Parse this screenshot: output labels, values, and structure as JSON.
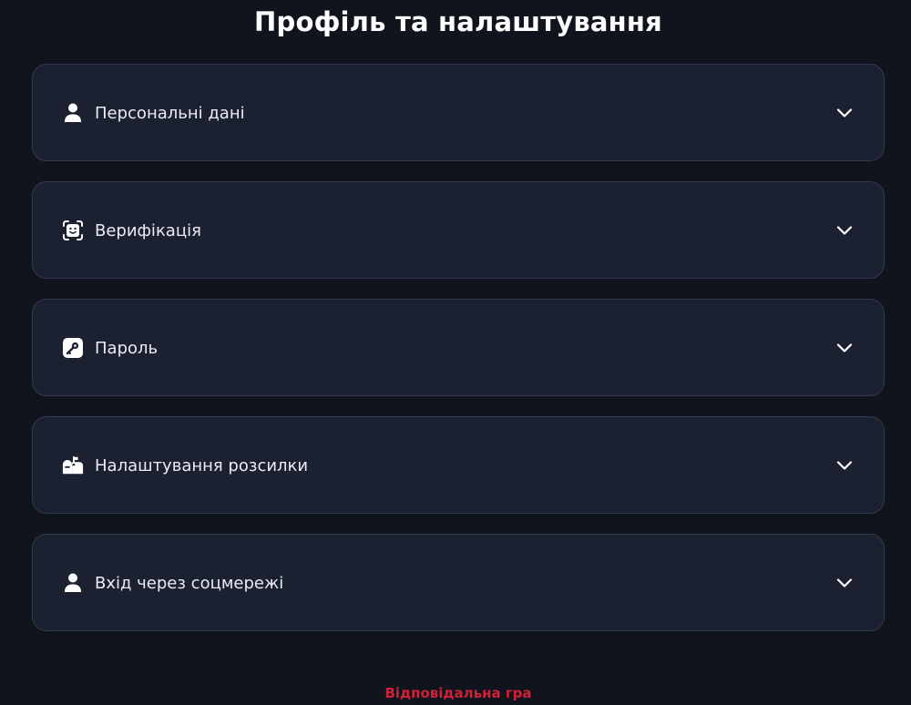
{
  "page": {
    "title": "Профіль та налаштування"
  },
  "sections": [
    {
      "label": "Персональні дані",
      "icon": "user-icon",
      "expanded": false
    },
    {
      "label": "Верифікація",
      "icon": "face-scan-icon",
      "expanded": false
    },
    {
      "label": "Пароль",
      "icon": "key-icon",
      "expanded": false
    },
    {
      "label": "Налаштування розсилки",
      "icon": "mailbox-icon",
      "expanded": false
    },
    {
      "label": "Вхід через соцмережі",
      "icon": "user-icon",
      "expanded": false
    }
  ],
  "footer": {
    "responsible_gaming": "Відповідальна гра"
  },
  "colors": {
    "background": "#10141c",
    "card": "#1b2130",
    "card_border": "#313a4e",
    "text": "#e9ecf2",
    "accent_red": "#d0203a"
  }
}
